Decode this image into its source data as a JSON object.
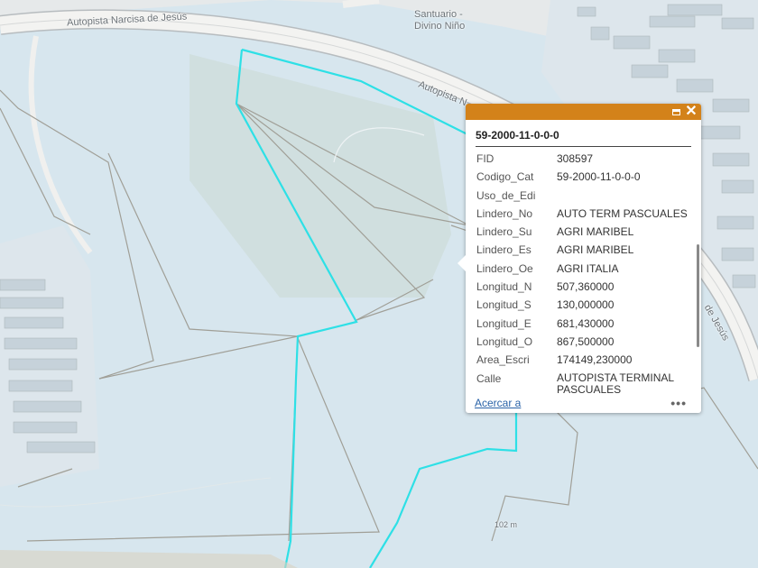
{
  "map": {
    "road_label_1": "Autopista Narcisa de Jesús",
    "road_label_2": "Autopista N",
    "road_label_3": "de Jesús",
    "place_label_line1": "Santuario -",
    "place_label_line2": "Divino Niño",
    "elevation_label": "102 m",
    "colors": {
      "background": "#d7e6ee",
      "road": "#f1f1ef",
      "parcel_outline": "#a09f97",
      "selection": "#2ee0e6",
      "popup_header": "#d3821a"
    }
  },
  "popup": {
    "title": "59-2000-11-0-0-0",
    "zoom_link": "Acercar a",
    "more_icon": "•••",
    "attributes": [
      {
        "key": "FID",
        "value": "308597"
      },
      {
        "key": "Codigo_Cat",
        "value": "59-2000-11-0-0-0"
      },
      {
        "key": "Uso_de_Edi",
        "value": ""
      },
      {
        "key": "Lindero_No",
        "value": "AUTO TERM PASCUALES"
      },
      {
        "key": "Lindero_Su",
        "value": "AGRI MARIBEL"
      },
      {
        "key": "Lindero_Es",
        "value": "AGRI MARIBEL"
      },
      {
        "key": "Lindero_Oe",
        "value": "AGRI ITALIA"
      },
      {
        "key": "Longitud_N",
        "value": "507,360000"
      },
      {
        "key": "Longitud_S",
        "value": "130,000000"
      },
      {
        "key": "Longitud_E",
        "value": "681,430000"
      },
      {
        "key": "Longitud_O",
        "value": "867,500000"
      },
      {
        "key": "Area_Escri",
        "value": "174149,230000"
      },
      {
        "key": "Calle",
        "value": "AUTOPISTA TERMINAL PASCUALES"
      }
    ]
  }
}
